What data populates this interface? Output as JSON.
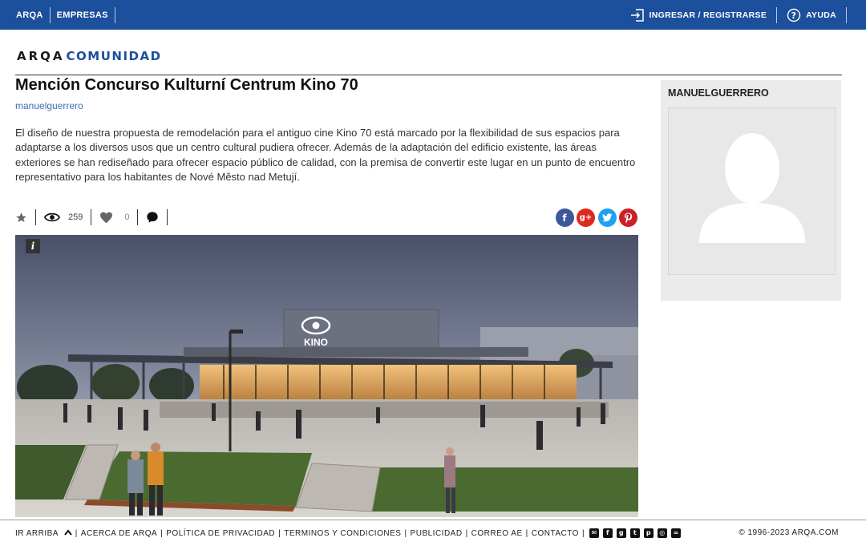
{
  "topbar": {
    "links": [
      "ARQA",
      "EMPRESAS"
    ],
    "login_label": "INGRESAR / REGISTRARSE",
    "help_label": "AYUDA"
  },
  "logo": {
    "part1": "ARQA",
    "part2": "COMUNIDAD"
  },
  "post": {
    "title": "Mención Concurso Kulturní Centrum Kino 70",
    "author": "manuelguerrero",
    "description": "El diseño de nuestra propuesta de remodelación para el antiguo cine Kino 70 está marcado por la flexibilidad de sus espacios para adaptarse a los diversos usos que un centro cultural pudiera ofrecer. Además de la adaptación del edificio existente, las áreas exteriores se han rediseñado para ofrecer espacio público de calidad, con la premisa de convertir este lugar en un punto de encuentro representativo para los habitantes de Nové Město nad Metují.",
    "views": "259",
    "likes": "0",
    "image_sign": "KINO",
    "info_badge": "i"
  },
  "share": {
    "facebook": "f",
    "googleplus": "g+",
    "twitter": "t",
    "pinterest": "p",
    "colors": {
      "facebook": "#3b5998",
      "googleplus": "#dd2a1f",
      "twitter": "#1da1f2",
      "pinterest": "#cb2027"
    }
  },
  "sidebar": {
    "username": "MANUELGUERRERO"
  },
  "footer": {
    "back_to_top": "IR ARRIBA",
    "links": [
      "ACERCA DE ARQA",
      "POLÍTICA DE PRIVACIDAD",
      "TERMINOS Y CONDICIONES",
      "PUBLICIDAD",
      "CORREO AE",
      "CONTACTO"
    ],
    "social_icons": [
      "mail-icon",
      "facebook-icon",
      "googleplus-icon",
      "twitter-icon",
      "pinterest-icon",
      "instagram-icon",
      "rss-icon"
    ],
    "copyright": "© 1996-2023 ARQA.COM"
  },
  "colors": {
    "topbar": "#1c4f9c",
    "link": "#3b6fb6"
  }
}
